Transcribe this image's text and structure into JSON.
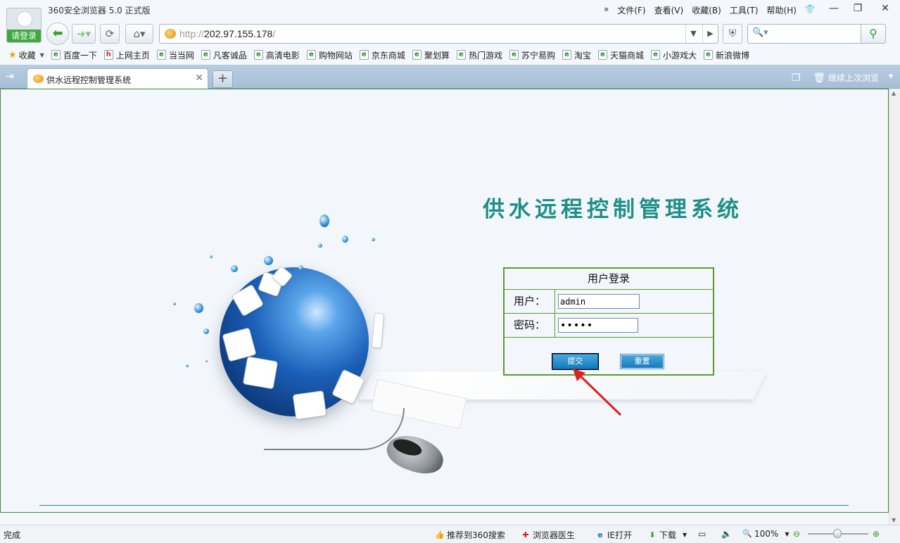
{
  "window": {
    "app_title": "360安全浏览器 5.0 正式版",
    "login_label": "请登录",
    "menu": [
      "文件(F)",
      "查看(V)",
      "收藏(B)",
      "工具(T)",
      "帮助(H)"
    ],
    "menu_more": "»"
  },
  "nav": {
    "url_protocol": "http://",
    "url_host": "202.97.155.178",
    "url_path": "/"
  },
  "bookmarks": {
    "favorites_label": "收藏",
    "items": [
      "百度一下",
      "上网主页",
      "当当网",
      "凡客诚品",
      "高清电影",
      "购物网站",
      "京东商城",
      "聚划算",
      "热门游戏",
      "苏宁易购",
      "淘宝",
      "天猫商城",
      "小游戏大",
      "新浪微博"
    ]
  },
  "tabs": {
    "active_title": "供水远程控制管理系统",
    "restore_label": "继续上次浏览"
  },
  "page": {
    "system_title": "供水远程控制管理系统",
    "login": {
      "heading": "用户登录",
      "user_label": "用户：",
      "user_value": "admin",
      "password_label": "密码：",
      "password_value": "•••••",
      "submit_label": "提交",
      "reset_label": "重置"
    }
  },
  "status": {
    "state": "完成",
    "recommend": "推荐到360搜索",
    "doctor": "浏览器医生",
    "ie_open": "IE打开",
    "download": "下载",
    "zoom": "100%",
    "zoom_level": 0.5
  },
  "colors": {
    "title_teal": "#1e8f86",
    "form_border": "#5b9a2f",
    "button_blue": "#1579b8",
    "annotation_arrow": "#e02020"
  }
}
